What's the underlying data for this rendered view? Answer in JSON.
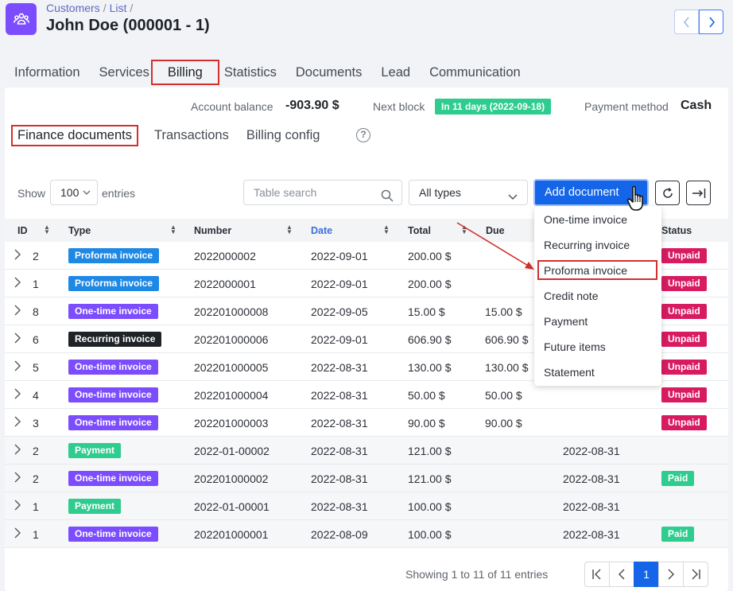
{
  "header": {
    "breadcrumb": [
      "Customers",
      "List"
    ],
    "title": "John Doe (000001 - 1)"
  },
  "tabs": [
    "Information",
    "Services",
    "Billing",
    "Statistics",
    "Documents",
    "Lead",
    "Communication"
  ],
  "account": {
    "balance_label": "Account balance",
    "balance_value": "-903.90 $",
    "next_block_label": "Next block",
    "next_block_badge": "In 11 days (2022-09-18)",
    "payment_method_label": "Payment method",
    "payment_method_value": "Cash"
  },
  "subtabs": [
    "Finance documents",
    "Transactions",
    "Billing config"
  ],
  "toolbar": {
    "show_label": "Show",
    "page_size": "100",
    "entries_label": "entries",
    "search_placeholder": "Table search",
    "type_filter": "All types",
    "add_button": "Add document"
  },
  "columns": [
    "ID",
    "Type",
    "Number",
    "Date",
    "Total",
    "Due",
    "Status"
  ],
  "rows": [
    {
      "id": "2",
      "type": "Proforma invoice",
      "number": "2022000002",
      "date": "2022-09-01",
      "total": "200.00 $",
      "due": "",
      "paid_date": "",
      "status": "Unpaid"
    },
    {
      "id": "1",
      "type": "Proforma invoice",
      "number": "2022000001",
      "date": "2022-09-01",
      "total": "200.00 $",
      "due": "",
      "paid_date": "",
      "status": "Unpaid"
    },
    {
      "id": "8",
      "type": "One-time invoice",
      "number": "202201000008",
      "date": "2022-09-05",
      "total": "15.00 $",
      "due": "15.00 $",
      "paid_date": "",
      "status": "Unpaid"
    },
    {
      "id": "6",
      "type": "Recurring invoice",
      "number": "202201000006",
      "date": "2022-09-01",
      "total": "606.90 $",
      "due": "606.90 $",
      "paid_date": "",
      "status": "Unpaid"
    },
    {
      "id": "5",
      "type": "One-time invoice",
      "number": "202201000005",
      "date": "2022-08-31",
      "total": "130.00 $",
      "due": "130.00 $",
      "paid_date": "",
      "status": "Unpaid"
    },
    {
      "id": "4",
      "type": "One-time invoice",
      "number": "202201000004",
      "date": "2022-08-31",
      "total": "50.00 $",
      "due": "50.00 $",
      "paid_date": "",
      "status": "Unpaid"
    },
    {
      "id": "3",
      "type": "One-time invoice",
      "number": "202201000003",
      "date": "2022-08-31",
      "total": "90.00 $",
      "due": "90.00 $",
      "paid_date": "",
      "status": "Unpaid"
    },
    {
      "id": "2",
      "type": "Payment",
      "number": "2022-01-00002",
      "date": "2022-08-31",
      "total": "121.00 $",
      "due": "",
      "paid_date": "2022-08-31",
      "status": ""
    },
    {
      "id": "2",
      "type": "One-time invoice",
      "number": "202201000002",
      "date": "2022-08-31",
      "total": "121.00 $",
      "due": "",
      "paid_date": "2022-08-31",
      "status": "Paid"
    },
    {
      "id": "1",
      "type": "Payment",
      "number": "2022-01-00001",
      "date": "2022-08-31",
      "total": "100.00 $",
      "due": "",
      "paid_date": "2022-08-31",
      "status": ""
    },
    {
      "id": "1",
      "type": "One-time invoice",
      "number": "202201000001",
      "date": "2022-08-09",
      "total": "100.00 $",
      "due": "",
      "paid_date": "2022-08-31",
      "status": "Paid"
    }
  ],
  "dropdown": [
    "One-time invoice",
    "Recurring invoice",
    "Proforma invoice",
    "Credit note",
    "Payment",
    "Future items",
    "Statement"
  ],
  "footer": {
    "showing": "Showing 1 to 11 of 11 entries",
    "current_page": "1"
  },
  "colors": {
    "accent": "#1565e8",
    "brand": "#7c4dff",
    "highlight": "#d32f2f",
    "unpaid": "#d81b60",
    "paid": "#2ecc8f"
  }
}
